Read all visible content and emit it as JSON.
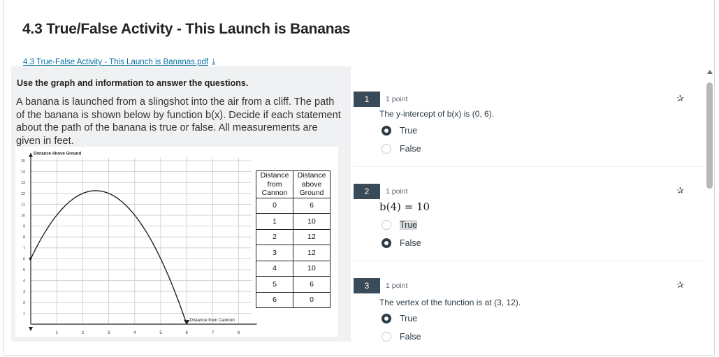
{
  "page": {
    "title": "4.3 True/False Activity - This Launch is Bananas",
    "pdf_link": "4.3 True-False Activity - This Launch is Bananas.pdf",
    "download_icon": "download-icon"
  },
  "stimulus": {
    "instructions": "Use the graph and information to answer the questions.",
    "problem_text": "A banana is launched from a slingshot into the air from a cliff. The path of the banana is shown below by function b(x). Decide if each statement about the path of the banana is true or false.  All measurements are given in feet."
  },
  "chart_data": {
    "type": "line",
    "title": "",
    "xlabel": "Distance from Cannon",
    "ylabel": "Distance Above Ground",
    "xlim": [
      0,
      8.5
    ],
    "ylim": [
      0,
      15.5
    ],
    "x_ticks": [
      "1",
      "2",
      "3",
      "4",
      "5",
      "6",
      "7",
      "8"
    ],
    "y_ticks": [
      "1",
      "2",
      "3",
      "4",
      "5",
      "6",
      "7",
      "8",
      "9",
      "10",
      "11",
      "12",
      "13",
      "14",
      "15"
    ],
    "grid": true,
    "series": [
      {
        "x": [
          0,
          0.5,
          1,
          1.5,
          2,
          2.5,
          3,
          3.5,
          4,
          4.5,
          5,
          5.5,
          6
        ],
        "y": [
          6,
          8.25,
          10,
          11.25,
          12,
          12.25,
          12,
          11.25,
          10,
          8.25,
          6,
          3.25,
          0
        ]
      }
    ],
    "table": {
      "headers": [
        "Distance from Cannon",
        "Distance above Ground"
      ],
      "rows": [
        [
          "0",
          "6"
        ],
        [
          "1",
          "10"
        ],
        [
          "2",
          "12"
        ],
        [
          "3",
          "12"
        ],
        [
          "4",
          "10"
        ],
        [
          "5",
          "6"
        ],
        [
          "6",
          "0"
        ]
      ]
    }
  },
  "questions": [
    {
      "number": "1",
      "points": "1 point",
      "text": "The y-intercept of b(x) is (0, 6).",
      "options": [
        "True",
        "False"
      ],
      "selected": "True"
    },
    {
      "number": "2",
      "points": "1 point",
      "text": "b(4) = 10",
      "options": [
        "True",
        "False"
      ],
      "selected": "False"
    },
    {
      "number": "3",
      "points": "1 point",
      "text": "The vertex of the function is at (3, 12).",
      "options": [
        "True",
        "False"
      ],
      "selected": "True"
    }
  ],
  "colors": {
    "accent": "#394b58",
    "link": "#0770a3",
    "panel": "#f0f1f2"
  }
}
